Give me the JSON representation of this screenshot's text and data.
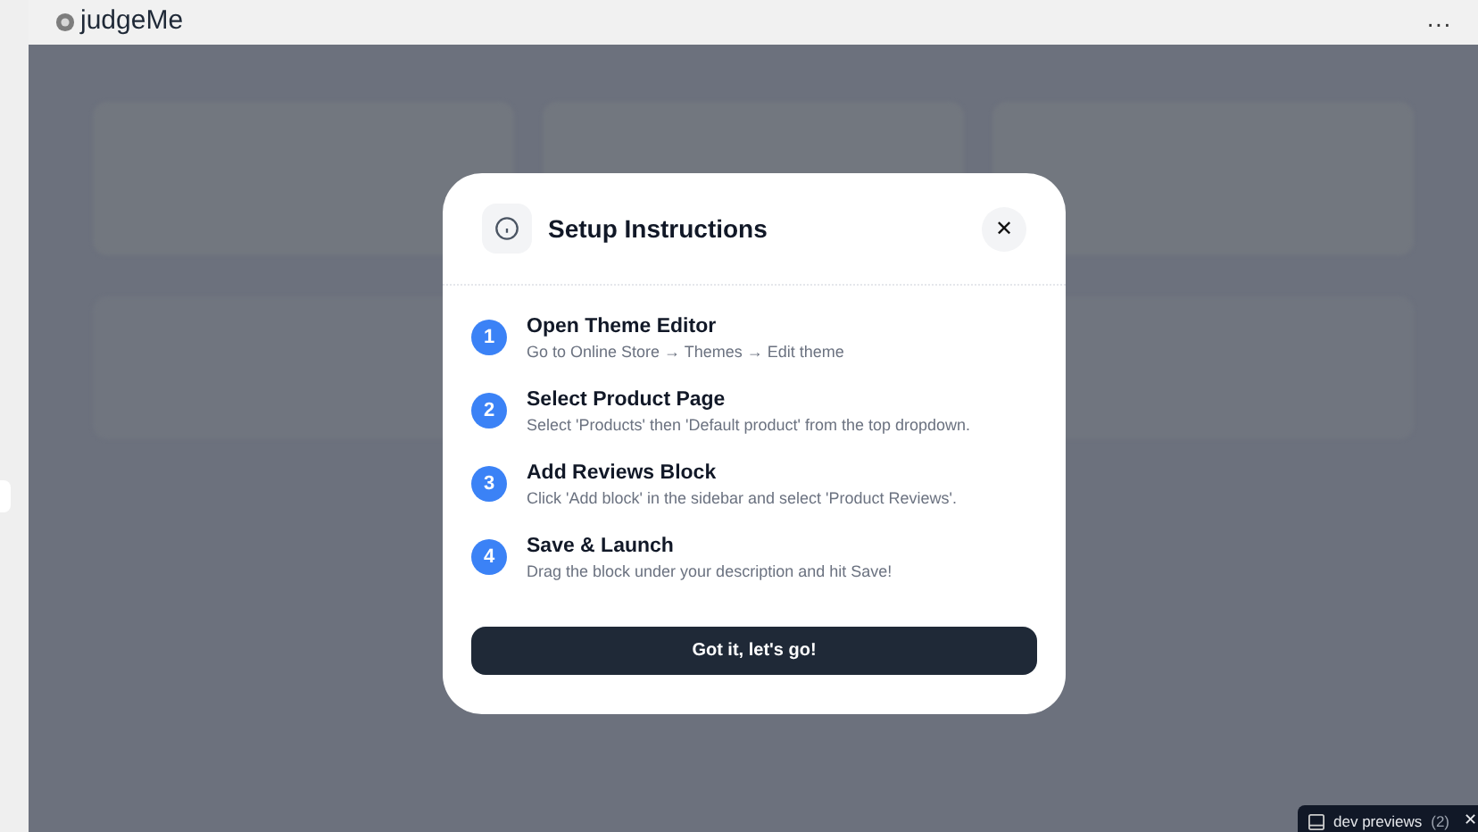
{
  "header": {
    "app_name": "judgeMe",
    "menu": "···"
  },
  "modal": {
    "title": "Setup Instructions",
    "close": "✕",
    "steps": [
      {
        "number": "1",
        "title": "Open Theme Editor",
        "description": "Go to Online Store → Themes → Edit theme"
      },
      {
        "number": "2",
        "title": "Select Product Page",
        "description": "Select 'Products' then 'Default product' from the top dropdown."
      },
      {
        "number": "3",
        "title": "Add Reviews Block",
        "description": "Click 'Add block' in the sidebar and select 'Product Reviews'."
      },
      {
        "number": "4",
        "title": "Save & Launch",
        "description": "Drag the block under your description and hit Save!"
      }
    ],
    "button": "Got it, let's go!"
  },
  "dev_toolbar": {
    "label": "dev previews",
    "count": "(2)",
    "close": "✕"
  }
}
